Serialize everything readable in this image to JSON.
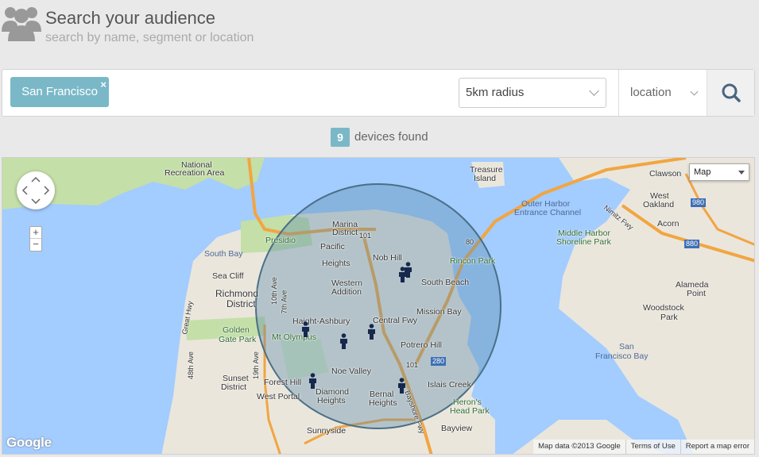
{
  "header": {
    "title": "Search your audience",
    "subtitle": "search by name, segment or location",
    "icon": "users-icon"
  },
  "search": {
    "tag_label": "San Francisco",
    "tag_close": "×",
    "radius_value": "5km radius",
    "filter_type": "location",
    "search_icon": "search-icon"
  },
  "results": {
    "count": "9",
    "label": "devices found"
  },
  "map": {
    "type_control": "Map",
    "zoom_in": "+",
    "zoom_out": "−",
    "logo": "Google",
    "footer": {
      "data": "Map data ©2013 Google",
      "terms": "Terms of Use",
      "report": "Report a map error"
    },
    "labels": {
      "national_rec_1": "National",
      "national_rec_2": "Recreation Area",
      "treasure_1": "Treasure",
      "treasure_2": "Island",
      "clawson": "Clawson",
      "west_oakland_1": "West",
      "west_oakland_2": "Oakland",
      "outer_harbor_1": "Outer Harbor",
      "outer_harbor_2": "Entrance Channel",
      "middle_harbor_1": "Middle Harbor",
      "middle_harbor_2": "Shoreline Park",
      "acorn": "Acorn",
      "south_bay": "South Bay",
      "presidio": "Presidio",
      "marina_1": "Marina",
      "marina_2": "District",
      "pacific_heights_1": "Pacific",
      "pacific_heights_2": "Heights",
      "nob_hill": "Nob Hill",
      "rincon_park": "Rincon Park",
      "sea_cliff": "Sea Cliff",
      "richmond_1": "Richmond",
      "richmond_2": "District",
      "western_addition_1": "Western",
      "western_addition_2": "Addition",
      "south_beach": "South Beach",
      "alameda_1": "Alameda",
      "alameda_2": "Point",
      "mission_bay": "Mission Bay",
      "woodstock_1": "Woodstock",
      "woodstock_2": "Park",
      "haight": "Haight-Ashbury",
      "golden_gate_1": "Golden",
      "golden_gate_2": "Gate Park",
      "central_fwy": "Central Fwy",
      "mt_olympus": "Mt Olympus",
      "potrero_1": "Potrero Hill",
      "san_fran_bay_1": "San",
      "san_fran_bay_2": "Francisco Bay",
      "noe_valley": "Noe Valley",
      "sunset_1": "Sunset",
      "sunset_2": "District",
      "forest_hill": "Forest Hill",
      "diamond_1": "Diamond",
      "diamond_2": "Heights",
      "west_portal": "West Portal",
      "bernal_1": "Bernal",
      "bernal_2": "Heights",
      "islais": "Islais Creek",
      "herons_1": "Heron's",
      "herons_2": "Head Park",
      "sunnyside": "Sunnyside",
      "bayview": "Bayview",
      "ave_19th": "19th Ave",
      "ave_10th": "10th Ave",
      "ave_7th": "7th Ave",
      "ave_48th": "48th Ave",
      "great_hwy": "Great Hwy",
      "hwy_101_a": "101",
      "hwy_101_b": "101",
      "hwy_280": "280",
      "hwy_80": "80",
      "hwy_980": "980",
      "hwy_880": "880",
      "nimitz": "Nimitz Fwy",
      "bayshore": "Bayshore Fwy"
    }
  }
}
